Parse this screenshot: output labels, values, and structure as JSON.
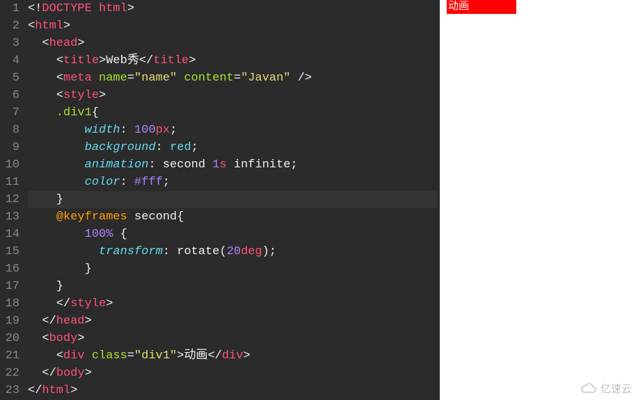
{
  "editor": {
    "lines": [
      {
        "n": 1,
        "tokens": [
          {
            "t": "<!",
            "c": "punc"
          },
          {
            "t": "DOCTYPE html",
            "c": "tag"
          },
          {
            "t": ">",
            "c": "punc"
          }
        ]
      },
      {
        "n": 2,
        "tokens": [
          {
            "t": "<",
            "c": "punc"
          },
          {
            "t": "html",
            "c": "tag"
          },
          {
            "t": ">",
            "c": "punc"
          }
        ]
      },
      {
        "n": 3,
        "tokens": [
          {
            "t": "  ",
            "c": "plain"
          },
          {
            "t": "<",
            "c": "punc"
          },
          {
            "t": "head",
            "c": "tag"
          },
          {
            "t": ">",
            "c": "punc"
          }
        ]
      },
      {
        "n": 4,
        "tokens": [
          {
            "t": "    ",
            "c": "plain"
          },
          {
            "t": "<",
            "c": "punc"
          },
          {
            "t": "title",
            "c": "tag"
          },
          {
            "t": ">",
            "c": "punc"
          },
          {
            "t": "Web秀",
            "c": "plain"
          },
          {
            "t": "</",
            "c": "punc"
          },
          {
            "t": "title",
            "c": "tag"
          },
          {
            "t": ">",
            "c": "punc"
          }
        ]
      },
      {
        "n": 5,
        "tokens": [
          {
            "t": "    ",
            "c": "plain"
          },
          {
            "t": "<",
            "c": "punc"
          },
          {
            "t": "meta",
            "c": "tag"
          },
          {
            "t": " ",
            "c": "plain"
          },
          {
            "t": "name",
            "c": "attr"
          },
          {
            "t": "=",
            "c": "punc"
          },
          {
            "t": "\"name\"",
            "c": "str"
          },
          {
            "t": " ",
            "c": "plain"
          },
          {
            "t": "content",
            "c": "attr"
          },
          {
            "t": "=",
            "c": "punc"
          },
          {
            "t": "\"Javan\"",
            "c": "str"
          },
          {
            "t": " />",
            "c": "punc"
          }
        ]
      },
      {
        "n": 6,
        "tokens": [
          {
            "t": "    ",
            "c": "plain"
          },
          {
            "t": "<",
            "c": "punc"
          },
          {
            "t": "style",
            "c": "tag"
          },
          {
            "t": ">",
            "c": "punc"
          }
        ]
      },
      {
        "n": 7,
        "tokens": [
          {
            "t": "    ",
            "c": "plain"
          },
          {
            "t": ".div1",
            "c": "sel"
          },
          {
            "t": "{",
            "c": "selbr"
          }
        ]
      },
      {
        "n": 8,
        "tokens": [
          {
            "t": "        ",
            "c": "plain"
          },
          {
            "t": "width",
            "c": "prop"
          },
          {
            "t": ": ",
            "c": "punc"
          },
          {
            "t": "100",
            "c": "num"
          },
          {
            "t": "px",
            "c": "unit"
          },
          {
            "t": ";",
            "c": "punc"
          }
        ]
      },
      {
        "n": 9,
        "tokens": [
          {
            "t": "        ",
            "c": "plain"
          },
          {
            "t": "background",
            "c": "prop"
          },
          {
            "t": ": ",
            "c": "punc"
          },
          {
            "t": "red",
            "c": "kw"
          },
          {
            "t": ";",
            "c": "punc"
          }
        ]
      },
      {
        "n": 10,
        "tokens": [
          {
            "t": "        ",
            "c": "plain"
          },
          {
            "t": "animation",
            "c": "prop"
          },
          {
            "t": ": ",
            "c": "punc"
          },
          {
            "t": "second ",
            "c": "val"
          },
          {
            "t": "1",
            "c": "num"
          },
          {
            "t": "s",
            "c": "unit"
          },
          {
            "t": " infinite",
            "c": "val"
          },
          {
            "t": ";",
            "c": "punc"
          }
        ]
      },
      {
        "n": 11,
        "tokens": [
          {
            "t": "        ",
            "c": "plain"
          },
          {
            "t": "color",
            "c": "prop"
          },
          {
            "t": ": ",
            "c": "punc"
          },
          {
            "t": "#fff",
            "c": "num"
          },
          {
            "t": ";",
            "c": "punc"
          }
        ]
      },
      {
        "n": 12,
        "tokens": [
          {
            "t": "    }",
            "c": "plain"
          }
        ],
        "hl": true
      },
      {
        "n": 13,
        "tokens": [
          {
            "t": "    ",
            "c": "plain"
          },
          {
            "t": "@keyframes",
            "c": "at"
          },
          {
            "t": " second",
            "c": "plain"
          },
          {
            "t": "{",
            "c": "selbr"
          }
        ]
      },
      {
        "n": 14,
        "tokens": [
          {
            "t": "        ",
            "c": "plain"
          },
          {
            "t": "100%",
            "c": "num"
          },
          {
            "t": " {",
            "c": "selbr"
          }
        ]
      },
      {
        "n": 15,
        "tokens": [
          {
            "t": "          ",
            "c": "plain"
          },
          {
            "t": "transform",
            "c": "prop"
          },
          {
            "t": ": ",
            "c": "punc"
          },
          {
            "t": "rotate",
            "c": "val"
          },
          {
            "t": "(",
            "c": "punc"
          },
          {
            "t": "20",
            "c": "num"
          },
          {
            "t": "deg",
            "c": "unit"
          },
          {
            "t": ")",
            "c": "punc"
          },
          {
            "t": ";",
            "c": "punc"
          }
        ]
      },
      {
        "n": 16,
        "tokens": [
          {
            "t": "        }",
            "c": "plain"
          }
        ]
      },
      {
        "n": 17,
        "tokens": [
          {
            "t": "    }",
            "c": "plain"
          }
        ]
      },
      {
        "n": 18,
        "tokens": [
          {
            "t": "    ",
            "c": "plain"
          },
          {
            "t": "</",
            "c": "punc"
          },
          {
            "t": "style",
            "c": "tag"
          },
          {
            "t": ">",
            "c": "punc"
          }
        ]
      },
      {
        "n": 19,
        "tokens": [
          {
            "t": "  ",
            "c": "plain"
          },
          {
            "t": "</",
            "c": "punc"
          },
          {
            "t": "head",
            "c": "tag"
          },
          {
            "t": ">",
            "c": "punc"
          }
        ]
      },
      {
        "n": 20,
        "tokens": [
          {
            "t": "  ",
            "c": "plain"
          },
          {
            "t": "<",
            "c": "punc"
          },
          {
            "t": "body",
            "c": "tag"
          },
          {
            "t": ">",
            "c": "punc"
          }
        ]
      },
      {
        "n": 21,
        "tokens": [
          {
            "t": "    ",
            "c": "plain"
          },
          {
            "t": "<",
            "c": "punc"
          },
          {
            "t": "div",
            "c": "tag"
          },
          {
            "t": " ",
            "c": "plain"
          },
          {
            "t": "class",
            "c": "attr"
          },
          {
            "t": "=",
            "c": "punc"
          },
          {
            "t": "\"div1\"",
            "c": "str"
          },
          {
            "t": ">",
            "c": "punc"
          },
          {
            "t": "动画",
            "c": "plain"
          },
          {
            "t": "</",
            "c": "punc"
          },
          {
            "t": "div",
            "c": "tag"
          },
          {
            "t": ">",
            "c": "punc"
          }
        ]
      },
      {
        "n": 22,
        "tokens": [
          {
            "t": "  ",
            "c": "plain"
          },
          {
            "t": "</",
            "c": "punc"
          },
          {
            "t": "body",
            "c": "tag"
          },
          {
            "t": ">",
            "c": "punc"
          }
        ]
      },
      {
        "n": 23,
        "tokens": [
          {
            "t": "</",
            "c": "punc"
          },
          {
            "t": "html",
            "c": "tag"
          },
          {
            "t": ">",
            "c": "punc"
          }
        ]
      }
    ]
  },
  "preview": {
    "box_text": "动画"
  },
  "watermark": {
    "text": "亿速云"
  }
}
